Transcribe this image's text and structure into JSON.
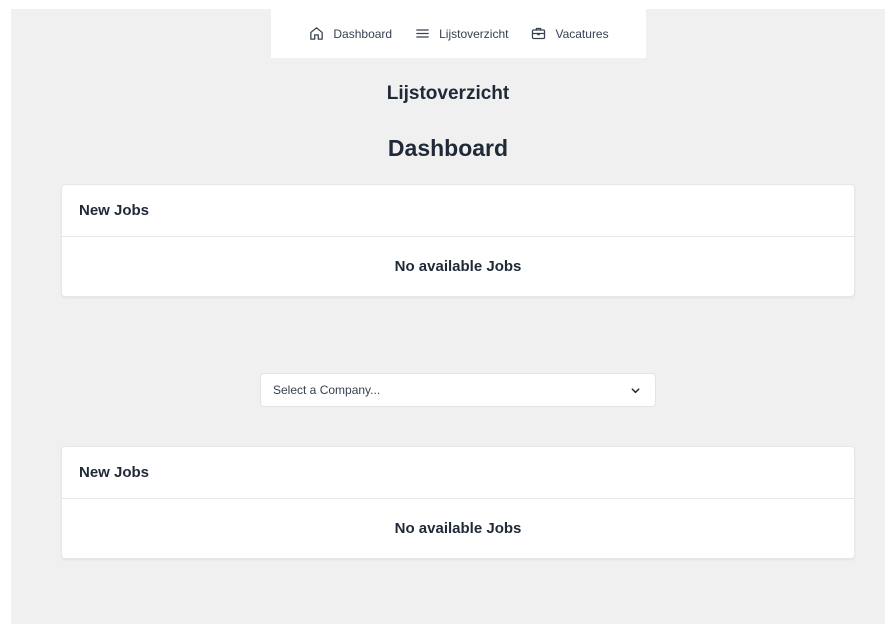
{
  "nav": {
    "items": [
      {
        "label": "Dashboard",
        "icon": "home-icon"
      },
      {
        "label": "Lijstoverzicht",
        "icon": "list-icon"
      },
      {
        "label": "Vacatures",
        "icon": "briefcase-icon"
      }
    ]
  },
  "page": {
    "subtitle": "Lijstoverzicht",
    "title": "Dashboard"
  },
  "cards": [
    {
      "header": "New Jobs",
      "body": "No available Jobs"
    },
    {
      "header": "New Jobs",
      "body": "No available Jobs"
    }
  ],
  "company_select": {
    "placeholder": "Select a Company...",
    "icon": "chevron-down-icon"
  }
}
